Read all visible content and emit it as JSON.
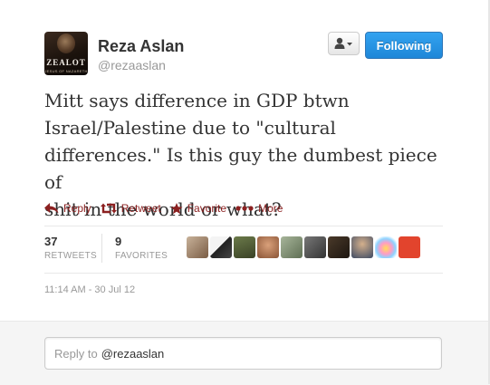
{
  "header": {
    "display_name": "Reza Aslan",
    "handle": "@rezaaslan",
    "avatar_book_title": "ZEALOT",
    "avatar_book_subtitle": "JESUS OF NAZARETH",
    "follow_label": "Following",
    "user_menu_icon": "person-dropdown-icon"
  },
  "tweet": {
    "lines": [
      "Mitt says difference in GDP btwn",
      "Israel/Palestine due to \"cultural",
      "differences.\" Is this guy the dumbest piece of",
      "shit in the world or what?"
    ]
  },
  "actions": {
    "reply": "Reply",
    "retweet": "Retweet",
    "favorite": "Favorite",
    "more": "More"
  },
  "stats": {
    "retweets_count": "37",
    "retweets_label": "RETWEETS",
    "favorites_count": "9",
    "favorites_label": "FAVORITES"
  },
  "timestamp": "11:14 AM - 30 Jul 12",
  "reply_box": {
    "prefix": "Reply to",
    "mention": "@rezaaslan"
  },
  "colors": {
    "action_text": "#8b2020",
    "follow_button": "#1e87d8",
    "tweet_text": "#333333"
  }
}
